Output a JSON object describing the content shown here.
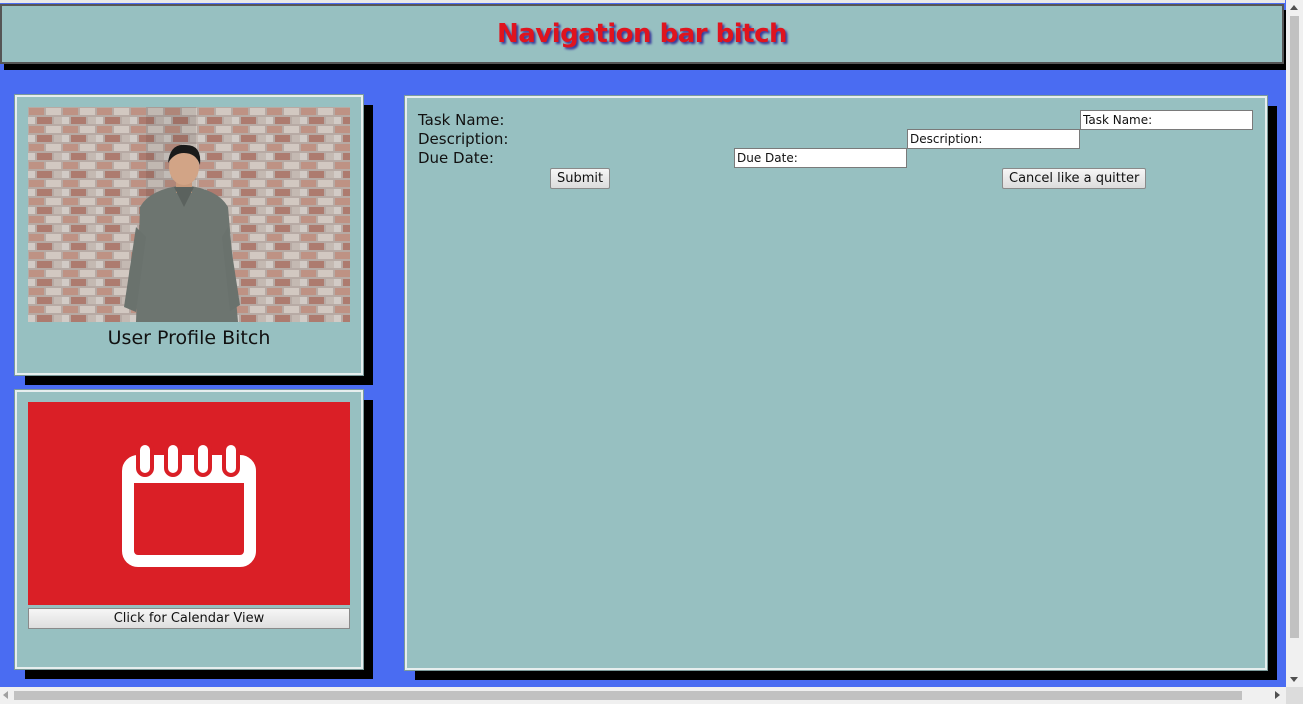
{
  "navbar": {
    "title": "Navigation bar bitch"
  },
  "profile": {
    "label": "User Profile Bitch",
    "photo_icon": "user-photo"
  },
  "calendar": {
    "button_label": "Click for Calendar View",
    "icon": "calendar-icon",
    "tile_color": "#da1f26"
  },
  "form": {
    "task_name_label": "Task Name:",
    "description_label": "Description:",
    "due_date_label": "Due Date:",
    "task_name_placeholder": "Task Name:",
    "description_placeholder": "Description:",
    "due_date_placeholder": "Due Date:",
    "submit_label": "Submit",
    "cancel_label": "Cancel like a quitter"
  },
  "colors": {
    "page_background": "#4a6cf2",
    "panel_background": "#97c0c1",
    "title_color": "#e0141e"
  }
}
